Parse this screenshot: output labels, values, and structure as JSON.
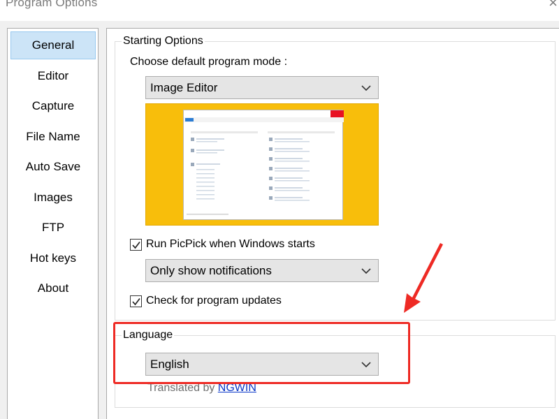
{
  "window": {
    "title": "Program Options",
    "close_glyph": "×"
  },
  "sidebar": {
    "items": [
      {
        "label": "General",
        "selected": true
      },
      {
        "label": "Editor"
      },
      {
        "label": "Capture"
      },
      {
        "label": "File Name"
      },
      {
        "label": "Auto Save"
      },
      {
        "label": "Images"
      },
      {
        "label": "FTP"
      },
      {
        "label": "Hot keys"
      },
      {
        "label": "About"
      }
    ]
  },
  "starting": {
    "legend": "Starting Options",
    "mode_label": "Choose default program mode :",
    "mode_value": "Image Editor",
    "run_label": "Run PicPick when Windows starts",
    "run_checked": true,
    "notify_value": "Only show notifications",
    "updates_label": "Check for program updates",
    "updates_checked": true
  },
  "language": {
    "legend": "Language",
    "value": "English",
    "translated_prefix": "Translated by ",
    "translator": "NGWIN"
  },
  "colors": {
    "highlight": "#ee2a24",
    "selected_bg": "#cce4f7",
    "preview_bg": "#f8be0b",
    "link": "#0b38c7"
  },
  "icons": [
    "close-icon",
    "chevron-down-icon",
    "checkmark-icon",
    "red-arrow-annotation"
  ]
}
